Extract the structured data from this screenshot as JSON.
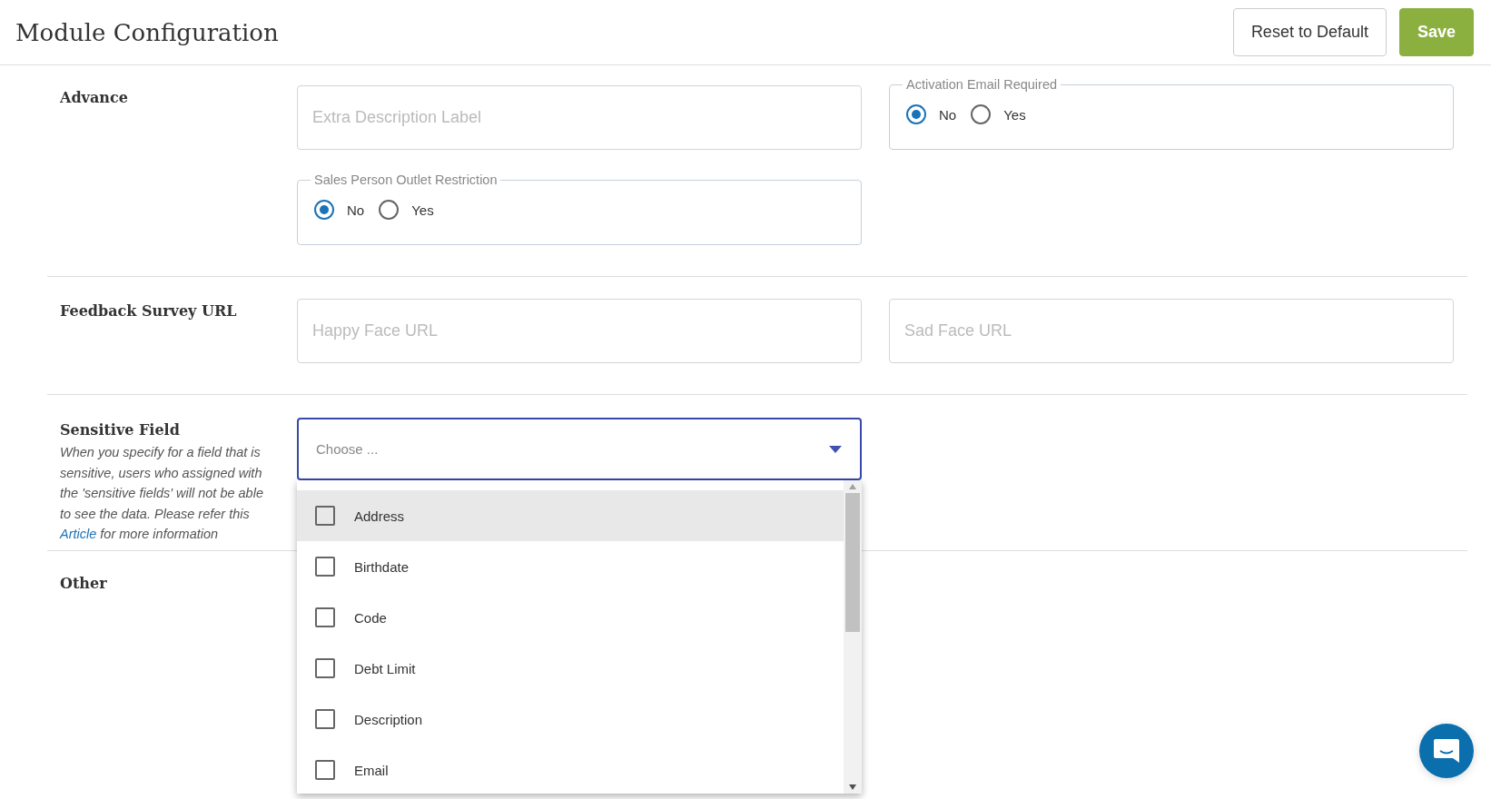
{
  "header": {
    "title": "Module Configuration",
    "buttons": [
      {
        "label": "Reset to Default",
        "kind": "outline"
      },
      {
        "label": "Save",
        "kind": "primary"
      }
    ]
  },
  "sections": [
    {
      "label": "Advance",
      "fields": [
        {
          "kind": "input",
          "placeholder": "Extra Description Label"
        },
        {
          "kind": "radio-group",
          "legend": "Activation Email Required",
          "options": [
            {
              "label": "No",
              "selected": true
            },
            {
              "label": "Yes",
              "selected": false
            }
          ]
        },
        {
          "kind": "radio-group",
          "legend": "Sales Person Outlet Restriction",
          "options": [
            {
              "label": "No",
              "selected": true
            },
            {
              "label": "Yes",
              "selected": false
            }
          ]
        }
      ]
    },
    {
      "label": "Feedback Survey URL",
      "fields": [
        {
          "kind": "input",
          "placeholder": "Happy Face URL"
        },
        {
          "kind": "input",
          "placeholder": "Sad Face URL"
        }
      ]
    },
    {
      "label": "Sensitive Field",
      "description": {
        "before": "When you specify for a field that is sensitive, users who assigned with the 'sensitive fields' will not be able to see the data. Please refer this",
        "link": "Article",
        "after": "for more information"
      },
      "fields": [
        {
          "kind": "select",
          "placeholder": "Choose ...",
          "open": true,
          "options": [
            {
              "label": "Address",
              "checked": false,
              "highlighted": true
            },
            {
              "label": "Birthdate",
              "checked": false,
              "highlighted": false
            },
            {
              "label": "Code",
              "checked": false,
              "highlighted": false
            },
            {
              "label": "Debt Limit",
              "checked": false,
              "highlighted": false
            },
            {
              "label": "Description",
              "checked": false,
              "highlighted": false
            },
            {
              "label": "Email",
              "checked": false,
              "highlighted": false
            }
          ]
        }
      ]
    },
    {
      "label": "Other"
    }
  ]
}
